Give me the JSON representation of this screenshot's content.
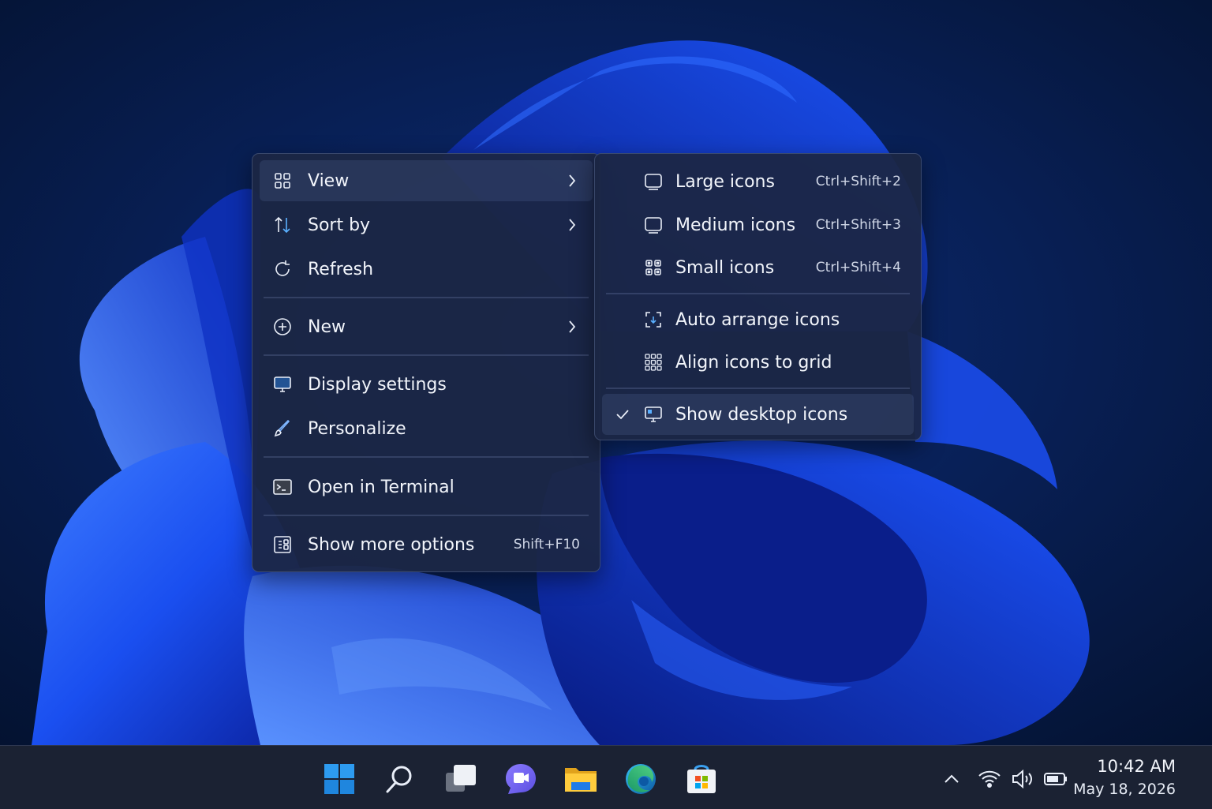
{
  "context_menu": {
    "items": [
      {
        "label": "View",
        "icon": "grid-view-icon"
      },
      {
        "label": "Sort by",
        "icon": "sort-arrows-icon"
      },
      {
        "label": "Refresh",
        "icon": "refresh-icon"
      },
      {
        "label": "New",
        "icon": "plus-circle-icon"
      },
      {
        "label": "Display settings",
        "icon": "monitor-icon"
      },
      {
        "label": "Personalize",
        "icon": "brush-icon"
      },
      {
        "label": "Open in Terminal",
        "icon": "terminal-icon"
      },
      {
        "label": "Show more options",
        "icon": "more-options-icon",
        "shortcut": "Shift+F10"
      }
    ]
  },
  "view_submenu": {
    "items": [
      {
        "label": "Large icons",
        "shortcut": "Ctrl+Shift+2",
        "icon": "square-icon"
      },
      {
        "label": "Medium icons",
        "shortcut": "Ctrl+Shift+3",
        "icon": "square-icon"
      },
      {
        "label": "Small icons",
        "shortcut": "Ctrl+Shift+4",
        "icon": "small-grid-icon"
      },
      {
        "label": "Auto arrange icons",
        "icon": "auto-arrange-icon"
      },
      {
        "label": "Align icons to grid",
        "icon": "dot-grid-icon"
      },
      {
        "label": "Show desktop icons",
        "icon": "desktop-icon",
        "checked": true
      }
    ]
  },
  "taskbar": {
    "apps": [
      "start-icon",
      "search-icon",
      "task-view-icon",
      "teams-chat-icon",
      "file-explorer-icon",
      "edge-icon",
      "store-icon"
    ],
    "tray": [
      "chevron-up-icon",
      "wifi-icon",
      "volume-icon",
      "battery-icon"
    ],
    "time": "10:42 AM",
    "date": "May 18, 2026"
  },
  "colors": {
    "accent": "#1e63ff",
    "menu_bg": "#1c2644",
    "taskbar_bg": "#1b2233",
    "desktop_bg": "#061a44"
  }
}
